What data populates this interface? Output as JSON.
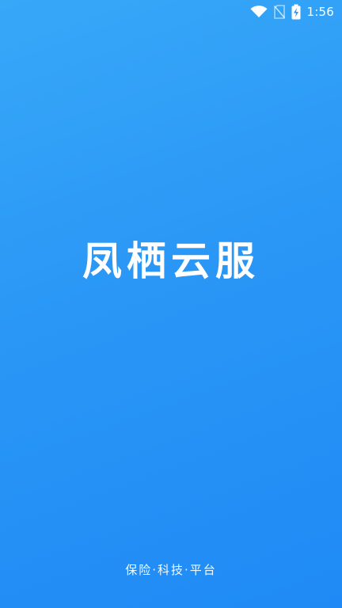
{
  "status_bar": {
    "time": "1:56",
    "icons": [
      "wifi-icon",
      "no-sim-icon",
      "battery-charging-icon"
    ]
  },
  "splash": {
    "title": "凤栖云服",
    "slogan": "保险·科技·平台"
  },
  "colors": {
    "background_top": "#37a8f8",
    "background_bottom": "#1f8af5",
    "text": "#ffffff"
  }
}
